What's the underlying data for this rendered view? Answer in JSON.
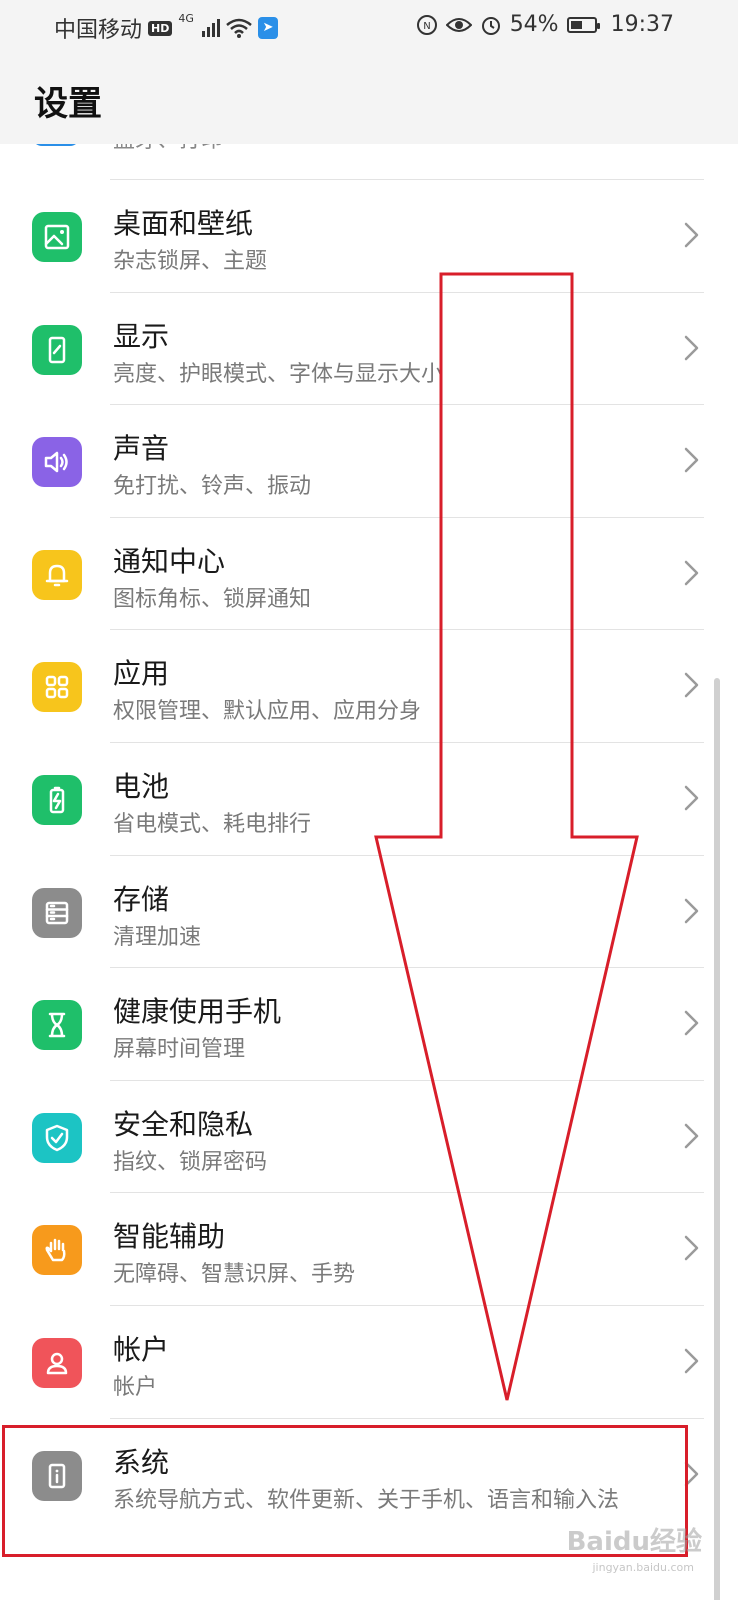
{
  "status_bar": {
    "carrier": "中国移动",
    "hd": "HD",
    "network": "4G",
    "battery": "54%",
    "battery_level": 0.54,
    "time": "19:37"
  },
  "header": {
    "title": "设置"
  },
  "partial_item": {
    "subtitle": "蓝牙、打印"
  },
  "items": [
    {
      "title": "桌面和壁纸",
      "subtitle": "杂志锁屏、主题",
      "icon": "wallpaper-icon",
      "color": "#1fbf6a"
    },
    {
      "title": "显示",
      "subtitle": "亮度、护眼模式、字体与显示大小",
      "icon": "display-icon",
      "color": "#1fbf6a"
    },
    {
      "title": "声音",
      "subtitle": "免打扰、铃声、振动",
      "icon": "speaker-icon",
      "color": "#8a63e6"
    },
    {
      "title": "通知中心",
      "subtitle": "图标角标、锁屏通知",
      "icon": "bell-icon",
      "color": "#f7c51c"
    },
    {
      "title": "应用",
      "subtitle": "权限管理、默认应用、应用分身",
      "icon": "apps-grid-icon",
      "color": "#f7c51c"
    },
    {
      "title": "电池",
      "subtitle": "省电模式、耗电排行",
      "icon": "battery-icon",
      "color": "#1fbf6a"
    },
    {
      "title": "存储",
      "subtitle": "清理加速",
      "icon": "storage-icon",
      "color": "#8c8c8c"
    },
    {
      "title": "健康使用手机",
      "subtitle": "屏幕时间管理",
      "icon": "hourglass-icon",
      "color": "#1fbf6a"
    },
    {
      "title": "安全和隐私",
      "subtitle": "指纹、锁屏密码",
      "icon": "shield-check-icon",
      "color": "#1cc4c4"
    },
    {
      "title": "智能辅助",
      "subtitle": "无障碍、智慧识屏、手势",
      "icon": "hand-icon",
      "color": "#f79a1c"
    },
    {
      "title": "帐户",
      "subtitle": "帐户",
      "icon": "person-icon",
      "color": "#f0545a"
    },
    {
      "title": "系统",
      "subtitle": "系统导航方式、软件更新、关于手机、语言和输入法",
      "icon": "info-icon",
      "color": "#8c8c8c"
    }
  ],
  "watermark": {
    "brand": "Baidu经验",
    "url": "jingyan.baidu.com"
  },
  "annotation_color": "#d81e2a"
}
